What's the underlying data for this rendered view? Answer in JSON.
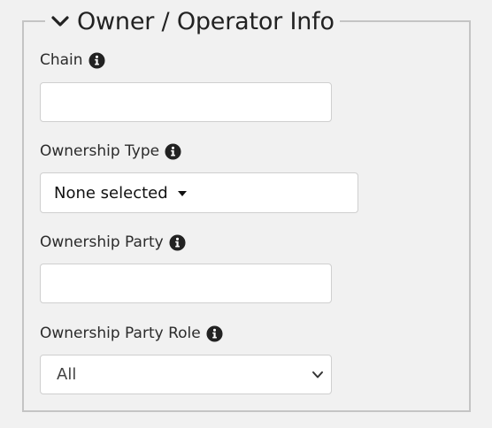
{
  "section": {
    "title": "Owner / Operator Info",
    "toggle_icon": "chevron-down-icon"
  },
  "fields": {
    "chain": {
      "label": "Chain",
      "value": "",
      "info_icon": "info-icon"
    },
    "ownership_type": {
      "label": "Ownership Type",
      "selected": "None selected",
      "info_icon": "info-icon"
    },
    "ownership_party": {
      "label": "Ownership Party",
      "value": "",
      "info_icon": "info-icon"
    },
    "ownership_party_role": {
      "label": "Ownership Party Role",
      "selected": "All",
      "info_icon": "info-icon"
    }
  },
  "colors": {
    "background": "#f1f1f1",
    "border": "#c4c4c4",
    "input_border": "#cfcfcf",
    "icon": "#222222"
  }
}
